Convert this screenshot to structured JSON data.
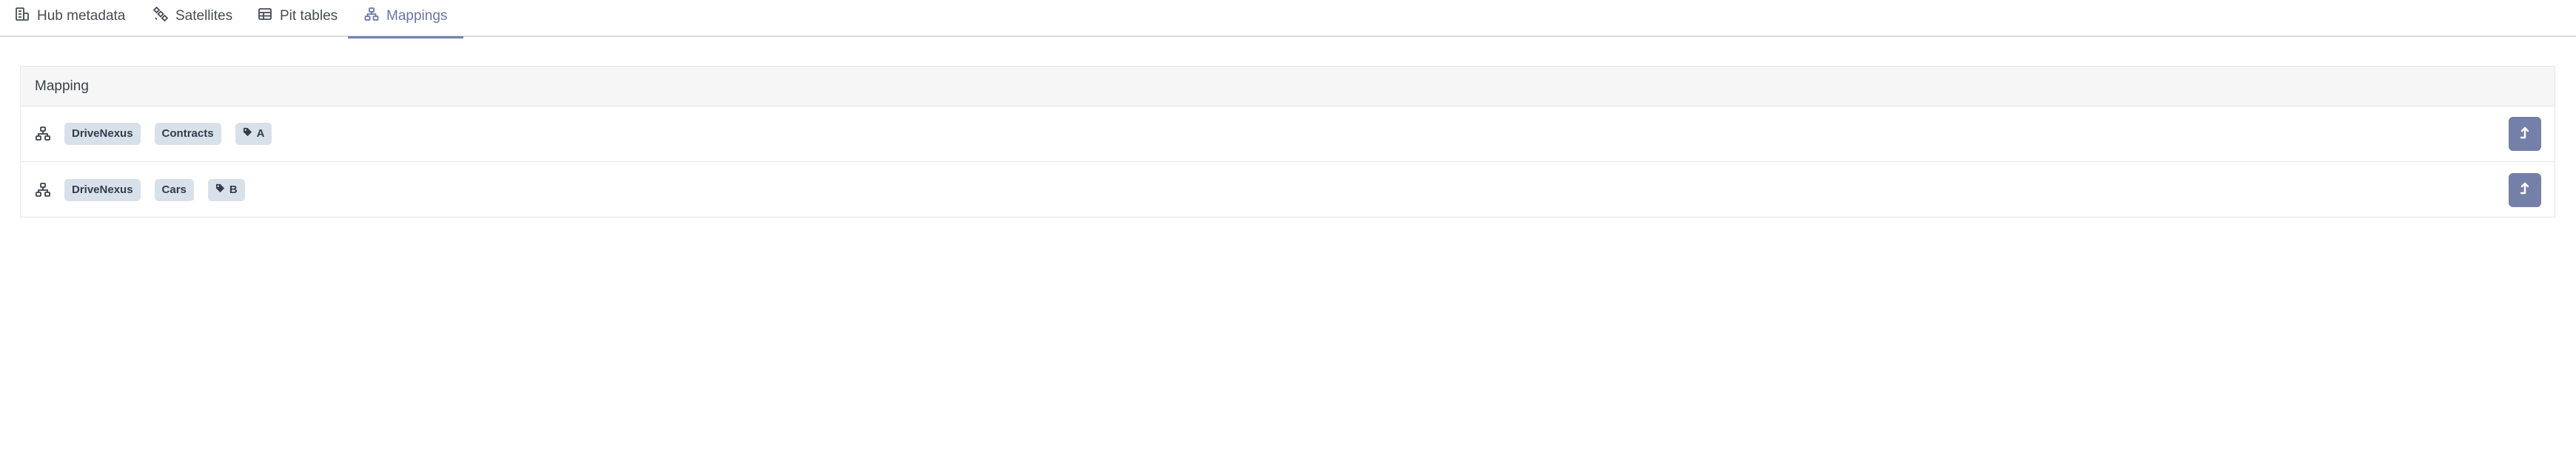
{
  "tabs": [
    {
      "label": "Hub metadata",
      "icon": "building-icon",
      "active": false
    },
    {
      "label": "Satellites",
      "icon": "satellite-icon",
      "active": false
    },
    {
      "label": "Pit tables",
      "icon": "table-icon",
      "active": false
    },
    {
      "label": "Mappings",
      "icon": "sitemap-icon",
      "active": true
    }
  ],
  "panel": {
    "header": "Mapping"
  },
  "mappings": [
    {
      "source": "DriveNexus",
      "entity": "Contracts",
      "tag": "A"
    },
    {
      "source": "DriveNexus",
      "entity": "Cars",
      "tag": "B"
    }
  ],
  "colors": {
    "accent": "#7480a8",
    "active_tab": "#6a74a6",
    "badge_bg": "#d8e1ea",
    "badge_text": "#2f3d4d",
    "header_bg": "#f6f6f6"
  }
}
